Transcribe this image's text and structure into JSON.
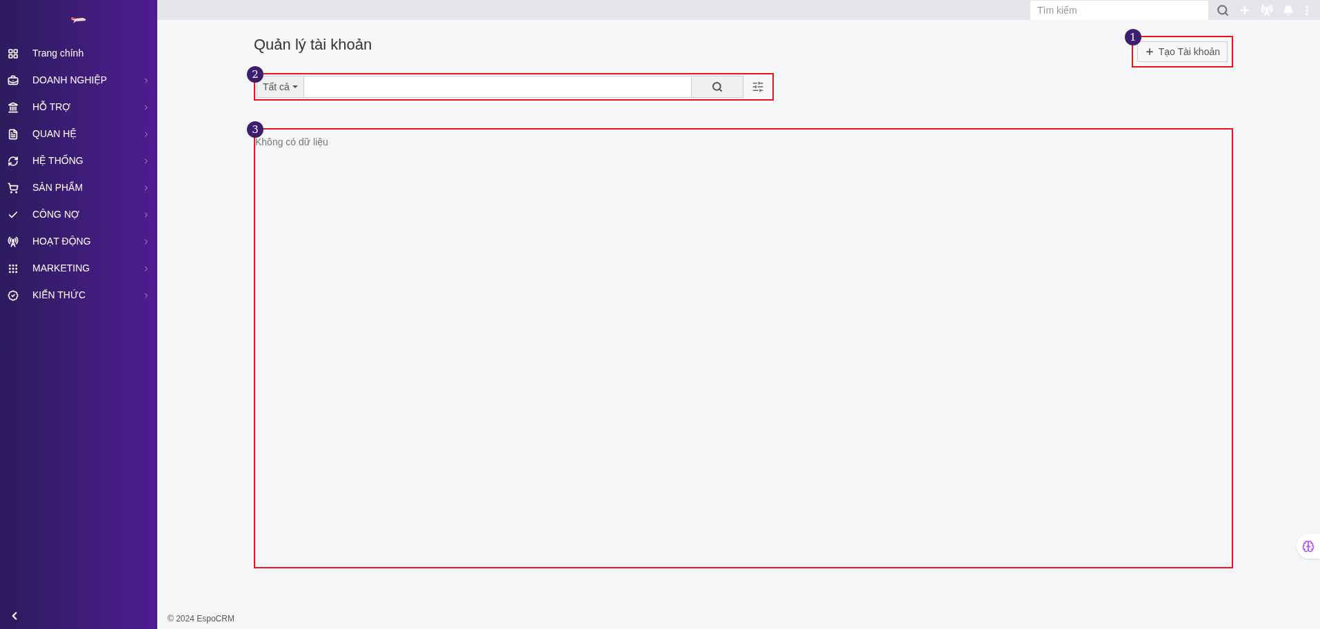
{
  "sidebar": {
    "items": [
      {
        "label": "Trang chính",
        "has_submenu": false
      },
      {
        "label": "DOANH NGHIỆP",
        "has_submenu": true
      },
      {
        "label": "HỖ TRỢ",
        "has_submenu": true
      },
      {
        "label": "QUAN HỆ",
        "has_submenu": true
      },
      {
        "label": "HỆ THỐNG",
        "has_submenu": true
      },
      {
        "label": "SẢN PHẨM",
        "has_submenu": true
      },
      {
        "label": "CÔNG NỢ",
        "has_submenu": true
      },
      {
        "label": "HOẠT ĐỘNG",
        "has_submenu": true
      },
      {
        "label": "MARKETING",
        "has_submenu": true
      },
      {
        "label": "KIẾN THỨC",
        "has_submenu": true
      }
    ]
  },
  "topbar": {
    "search": {
      "placeholder": "Tìm kiếm"
    }
  },
  "page": {
    "title": "Quản lý tài khoản",
    "create_button": "Tạo Tài khoản",
    "filter": {
      "value": "Tất cả"
    },
    "empty_text": "Không có dữ liệu"
  },
  "annotations": [
    "1",
    "2",
    "3"
  ],
  "footer": "© 2024 EspoCRM"
}
